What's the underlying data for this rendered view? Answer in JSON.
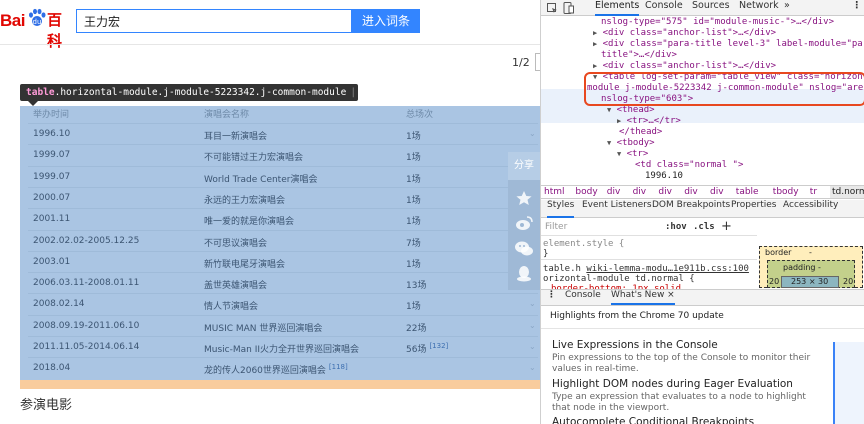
{
  "search": {
    "value": "王力宏",
    "button": "进入词条"
  },
  "logo": {
    "bai": "Bai",
    "du": "百科"
  },
  "pager": "1/2",
  "tooltip": {
    "tag": "table",
    "classes": ".horizontal-module.j-module-5223342.j-common-module",
    "size": "790 × 398"
  },
  "table": {
    "headers": [
      "举办时间",
      "演唱会名称",
      "总场次"
    ],
    "rows": [
      {
        "date": "1996.10",
        "name": "耳目一新演唱会",
        "count": "1场",
        "ref": ""
      },
      {
        "date": "1999.07",
        "name": "不可能错过王力宏演唱会",
        "count": "1场",
        "ref": ""
      },
      {
        "date": "1999.07",
        "name": "World Trade Center演唱会",
        "count": "1场",
        "ref": ""
      },
      {
        "date": "2000.07",
        "name": "永远的王力宏演唱会",
        "count": "1场",
        "ref": ""
      },
      {
        "date": "2001.11",
        "name": "唯一爱的就是你演唱会",
        "count": "1场",
        "ref": ""
      },
      {
        "date": "2002.02.02-2005.12.25",
        "name": "不可思议演唱会",
        "count": "7场",
        "ref": ""
      },
      {
        "date": "2003.01",
        "name": "新竹联电尾牙演唱会",
        "count": "1场",
        "ref": ""
      },
      {
        "date": "2006.03.11-2008.01.11",
        "name": "盖世英雄演唱会",
        "count": "13场",
        "ref": ""
      },
      {
        "date": "2008.02.14",
        "name": "情人节演唱会",
        "count": "1场",
        "ref": ""
      },
      {
        "date": "2008.09.19-2011.06.10",
        "name": "MUSIC MAN 世界巡回演唱会",
        "count": "22场",
        "ref": ""
      },
      {
        "date": "2011.11.05-2014.06.14",
        "name": "Music-Man II火力全开世界巡回演唱会",
        "count": "56场",
        "ref": "[132]"
      },
      {
        "date": "2018.04",
        "name": "龙的传人2060世界巡回演唱会",
        "count": "",
        "ref": "[118]"
      }
    ]
  },
  "share": {
    "label": "分享",
    "icons": [
      "star-icon",
      "weibo-icon",
      "wechat-icon",
      "qq-icon"
    ]
  },
  "section_title": "参演电影",
  "devtools": {
    "tabs": [
      "Elements",
      "Console",
      "Sources",
      "Network",
      "»"
    ],
    "dom_lines": [
      "nslog-type=\"575\" id=\"module-music-\">…</div>",
      "<div class=\"anchor-list\">…</div>",
      "<div class=\"para-title level-3\" label-module=\"para-",
      "title\">…</div>",
      "<div class=\"anchor-list\">…</div>",
      "<table log-set-param=\"table_view\" class=\"horizontal-",
      "module j-module-5223342 j-common-module\" nslog=\"area\"",
      "nslog-type=\"603\">",
      "<thead>",
      "<tr>…</tr>",
      "</thead>",
      "<tbody>",
      "<tr>",
      "<td class=\"normal \">",
      "1996.10"
    ],
    "breadcrumbs": [
      "html",
      "body",
      "div",
      "div",
      "div",
      "div",
      "div",
      "table",
      "tbody",
      "tr",
      "td.normal"
    ],
    "sub_tabs": [
      "Styles",
      "Event Listeners",
      "DOM Breakpoints",
      "Properties",
      "Accessibility"
    ],
    "filter_placeholder": "Filter",
    "hov": ":hov",
    "cls": ".cls",
    "plus": "+",
    "element_style": "element.style {",
    "close_brace": "}",
    "rule_selector": "table.h",
    "rule_link": "wiki-lemma-modu…1e911b.css:100",
    "rule_selector2": "orizontal-module td.normal {",
    "rule_prop": "border-bottom: 1px solid",
    "boxmodel": {
      "border": "border",
      "dash": "-",
      "padding": "padding -",
      "content": "253 × 30",
      "left": "20",
      "right": "20"
    },
    "drawer_tabs": [
      "Console",
      "What's New ×"
    ],
    "whats_new": {
      "headline": "Highlights from the Chrome 70 update",
      "items": [
        {
          "title": "Live Expressions in the Console",
          "desc": "Pin expressions to the top of the Console to monitor their values in real-time."
        },
        {
          "title": "Highlight DOM nodes during Eager Evaluation",
          "desc": "Type an expression that evaluates to a node to highlight that node in the viewport."
        },
        {
          "title": "Autocomplete Conditional Breakpoints",
          "desc": ""
        }
      ]
    }
  }
}
